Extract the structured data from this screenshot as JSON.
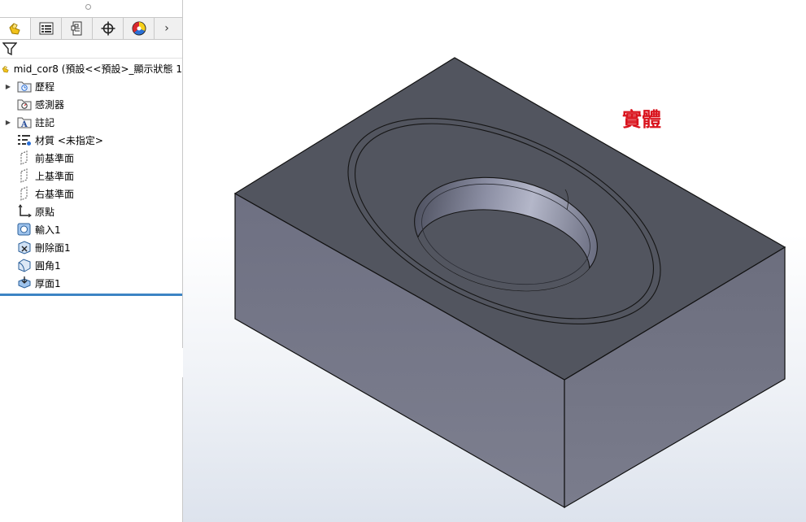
{
  "feature_tree": {
    "root": "mid_cor8 (預設<<預設>_顯示狀態 1",
    "items": [
      {
        "label": "歷程",
        "icon": "history-icon",
        "expandable": true
      },
      {
        "label": "感測器",
        "icon": "sensor-folder-icon",
        "expandable": false
      },
      {
        "label": "註記",
        "icon": "annotations-icon",
        "expandable": true
      },
      {
        "label": "材質 <未指定>",
        "icon": "material-icon",
        "expandable": false
      },
      {
        "label": "前基準面",
        "icon": "plane-icon",
        "expandable": false
      },
      {
        "label": "上基準面",
        "icon": "plane-icon",
        "expandable": false
      },
      {
        "label": "右基準面",
        "icon": "plane-icon",
        "expandable": false
      },
      {
        "label": "原點",
        "icon": "origin-icon",
        "expandable": false
      },
      {
        "label": "輸入1",
        "icon": "imported-body-icon",
        "expandable": false
      },
      {
        "label": "刪除面1",
        "icon": "delete-face-icon",
        "expandable": false
      },
      {
        "label": "圓角1",
        "icon": "fillet-icon",
        "expandable": false
      },
      {
        "label": "厚面1",
        "icon": "thicken-icon",
        "expandable": false
      }
    ]
  },
  "tabs": [
    "feature-manager-tab",
    "property-manager-tab",
    "configuration-manager-tab",
    "dimxpert-manager-tab",
    "display-manager-tab"
  ],
  "viewport": {
    "annotation": "實體",
    "annotation_color": "#d9141e",
    "model_colors": {
      "top_face": "#52555f",
      "front_face": "#7a7c8c",
      "right_face": "#6e7080"
    }
  }
}
